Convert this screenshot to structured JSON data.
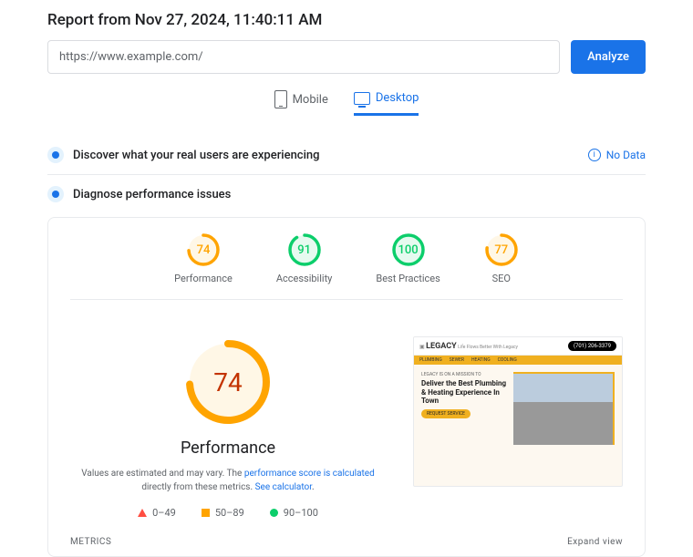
{
  "report_title": "Report from Nov 27, 2024, 11:40:11 AM",
  "url_input": {
    "value": "https://www.example.com/"
  },
  "analyze_label": "Analyze",
  "tabs": {
    "mobile": "Mobile",
    "desktop": "Desktop",
    "active": "desktop"
  },
  "discover": {
    "title": "Discover what your real users are experiencing",
    "no_data": "No Data"
  },
  "diagnose": {
    "title": "Diagnose performance issues"
  },
  "gauges": [
    {
      "label": "Performance",
      "score": 74,
      "color": "#ffa400",
      "bg": "#fff7e6"
    },
    {
      "label": "Accessibility",
      "score": 91,
      "color": "#0cce6b",
      "bg": "#e6faf0"
    },
    {
      "label": "Best Practices",
      "score": 100,
      "color": "#0cce6b",
      "bg": "#e6faf0"
    },
    {
      "label": "SEO",
      "score": 77,
      "color": "#ffa400",
      "bg": "#fff7e6"
    }
  ],
  "main_perf": {
    "score": 74,
    "title": "Performance",
    "desc_pre": "Values are estimated and may vary. The ",
    "link1": "performance score is calculated",
    "desc_mid": " directly from these metrics. ",
    "link2": "See calculator",
    "desc_post": "."
  },
  "legend": {
    "r1": "0–49",
    "r2": "50–89",
    "r3": "90–100"
  },
  "preview": {
    "logo": "LEGACY",
    "tagline": "Life Flows Better With Legacy",
    "phone": "(701) 206-3379",
    "mission": "LEGACY IS ON A MISSION TO",
    "headline": "Deliver the Best Plumbing & Heating Experience In Town",
    "cta": "REQUEST SERVICE"
  },
  "footer": {
    "metrics": "METRICS",
    "expand": "Expand view"
  }
}
